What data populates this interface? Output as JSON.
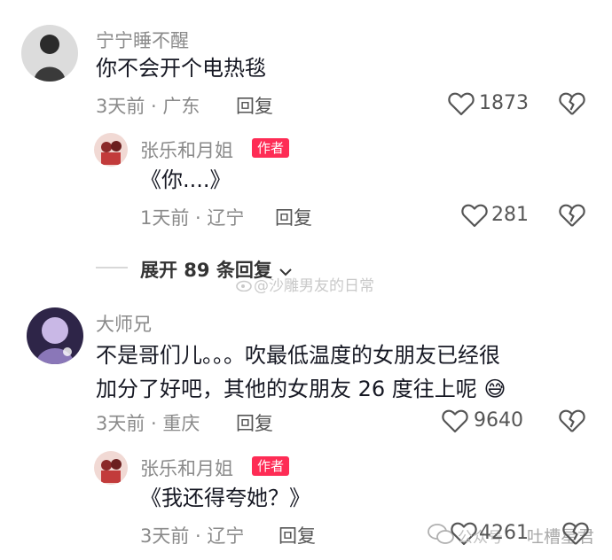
{
  "watermark": "@沙雕男友的日常",
  "footer_watermark": {
    "prefix": "公众号",
    "name": "吐槽星君"
  },
  "comments": [
    {
      "user": "宁宁睡不醒",
      "lines": [
        "你不会开个电热毯"
      ],
      "date": "3天前",
      "location": "广东",
      "reply": "回复",
      "likes": "1873",
      "replies": [
        {
          "user": "张乐和月姐",
          "badge": "作者",
          "lines": [
            "《你....》"
          ],
          "date": "1天前",
          "location": "辽宁",
          "reply": "回复",
          "likes": "281"
        }
      ],
      "expand_label": "展开 89 条回复"
    },
    {
      "user": "大师兄",
      "lines": [
        "不是哥们儿。。。吹最低温度的女朋友已经很",
        "加分了好吧，其他的女朋友 26 度往上呢"
      ],
      "emoji": "😅",
      "date": "3天前",
      "location": "重庆",
      "reply": "回复",
      "likes": "9640",
      "replies": [
        {
          "user": "张乐和月姐",
          "badge": "作者",
          "lines": [
            "《我还得夸她？》"
          ],
          "date": "3天前",
          "location": "辽宁",
          "reply": "回复",
          "likes": "4261"
        }
      ]
    }
  ],
  "icons": {
    "like": "heart-outline-icon",
    "dislike": "broken-heart-icon",
    "expand": "chevron-down-icon",
    "watermark": "weibo-logo-icon",
    "wechat": "wechat-logo-icon"
  },
  "colors": {
    "author_badge": "#fe2c55",
    "muted_text": "#8a8a8a"
  }
}
